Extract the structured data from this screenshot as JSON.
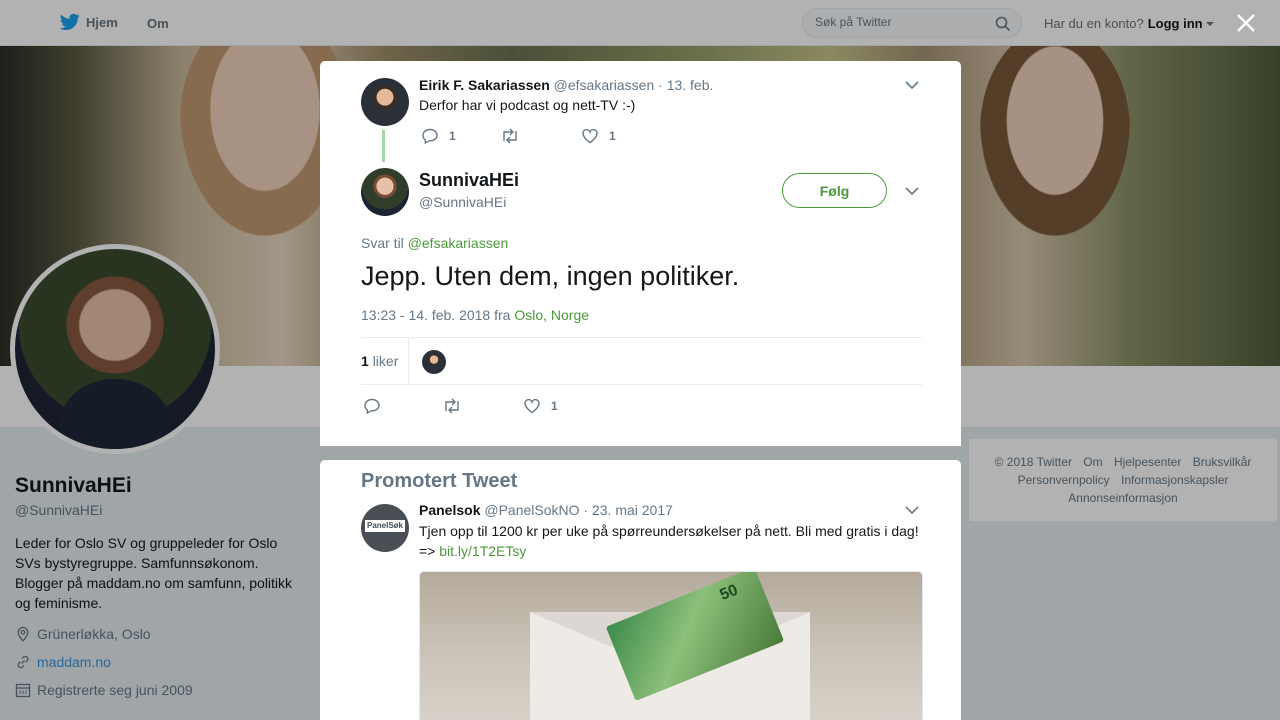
{
  "topbar": {
    "home_label": "Hjem",
    "about_label": "Om",
    "search_placeholder": "Søk på Twitter",
    "account_prompt": "Har du en konto?",
    "login_label": "Logg inn"
  },
  "profile": {
    "name": "SunnivaHEi",
    "handle": "@SunnivaHEi",
    "bio": "Leder for Oslo SV og gruppeleder for Oslo SVs bystyregruppe. Samfunnsøkonom. Blogger på maddam.no om samfunn, politikk og feminisme.",
    "location": "Grünerløkka, Oslo",
    "website": "maddam.no",
    "joined": "Registrerte seg juni 2009"
  },
  "footer": {
    "links": [
      "© 2018 Twitter",
      "Om",
      "Hjelpesenter",
      "Bruksvilkår",
      "Personvernpolicy",
      "Informasjonskapsler",
      "Annonseinformasjon"
    ]
  },
  "parent_tweet": {
    "name": "Eirik F. Sakariassen",
    "handle": "@efsakariassen",
    "date": "· 13. feb.",
    "text": "Derfor har vi podcast og nett-TV :-)",
    "replies": "1",
    "likes": "1"
  },
  "main_tweet": {
    "name": "SunnivaHEi",
    "handle": "@SunnivaHEi",
    "follow_label": "Følg",
    "reply_prefix": "Svar til",
    "reply_to": "@efsakariassen",
    "text": "Jepp. Uten dem, ingen politiker.",
    "timestamp": "13:23 - 14. feb. 2018 fra",
    "location": "Oslo, Norge",
    "like_count": "1",
    "like_label": "liker",
    "footer_likes": "1"
  },
  "promoted": {
    "title": "Promotert Tweet",
    "name": "Panelsok",
    "handle": "@PanelSokNO",
    "date": "· 23. mai 2017",
    "text": "Tjen opp til 1200 kr per uke på spørreundersøkelser på nett. Bli med gratis i dag! =>",
    "link": "bit.ly/1T2ETsy",
    "logo_text": "PanelSøk",
    "banknote_value": "50"
  },
  "colors": {
    "accent_green": "#4a9a3a",
    "twitter_blue": "#1da1f2",
    "muted": "#657786"
  }
}
